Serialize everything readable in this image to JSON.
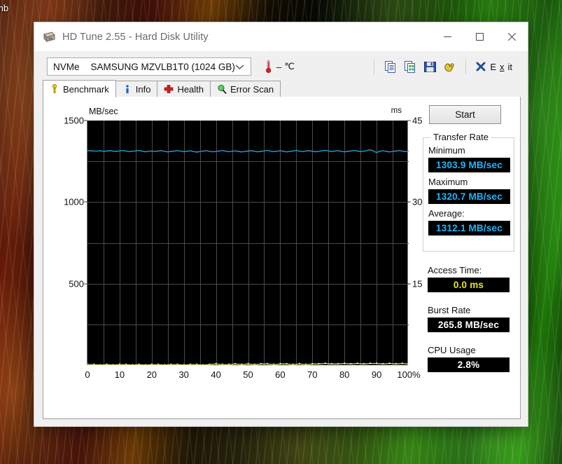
{
  "desktop": {
    "icon_label_fragment": "mb"
  },
  "window": {
    "title": "HD Tune 2.55 - Hard Disk Utility",
    "icon": "hard-disk-icon",
    "caption": {
      "minimize": "minimize-icon",
      "maximize": "maximize-icon",
      "close": "close-icon"
    }
  },
  "toolbar": {
    "drive": {
      "kind": "NVMe",
      "name": "SAMSUNG MZVLB1T0 (1024 GB)",
      "dropdown_icon": "chevron-down-icon"
    },
    "temperature": {
      "icon": "thermometer-icon",
      "value": "–",
      "unit": "℃"
    },
    "buttons": [
      {
        "name": "copy-icon",
        "label": "Copy"
      },
      {
        "name": "copy-image-icon",
        "label": "Copy image"
      },
      {
        "name": "save-icon",
        "label": "Save"
      },
      {
        "name": "settings-gloves-icon",
        "label": "Options"
      }
    ],
    "exit": {
      "icon": "exit-x-icon",
      "label_pre": "E",
      "label_accel": "x",
      "label_post": "it"
    }
  },
  "tabs": [
    {
      "id": "benchmark",
      "label": "Benchmark",
      "icon": "benchmark-icon",
      "active": true
    },
    {
      "id": "info",
      "label": "Info",
      "icon": "info-icon",
      "active": false
    },
    {
      "id": "health",
      "label": "Health",
      "icon": "health-cross-icon",
      "active": false
    },
    {
      "id": "errorscan",
      "label": "Error Scan",
      "icon": "magnifier-icon",
      "active": false
    }
  ],
  "side_panel": {
    "start_label": "Start",
    "transfer_rate": {
      "group_title": "Transfer Rate",
      "minimum_label": "Minimum",
      "minimum_value": "1303.9 MB/sec",
      "maximum_label": "Maximum",
      "maximum_value": "1320.7 MB/sec",
      "average_label": "Average:",
      "average_value": "1312.1 MB/sec"
    },
    "access_time_label": "Access Time:",
    "access_time_value": "0.0 ms",
    "burst_rate_label": "Burst Rate",
    "burst_rate_value": "265.8 MB/sec",
    "cpu_usage_label": "CPU Usage",
    "cpu_usage_value": "2.8%"
  },
  "colors": {
    "transfer_line": "#1f9fd8",
    "access_dots": "#ffff99",
    "plot_background": "#000000",
    "grid": "#4a4a4a",
    "lcd_cyan": "#1fb6ff",
    "lcd_yellow": "#e8e80e"
  },
  "chart_data": {
    "type": "line",
    "title": "",
    "xlabel": "",
    "ylabel": "MB/sec",
    "y2label": "ms",
    "xlim": [
      0,
      100
    ],
    "ylim": [
      0,
      1500
    ],
    "y2lim": [
      0,
      45
    ],
    "xtick_labels": [
      "0",
      "10",
      "20",
      "30",
      "40",
      "50",
      "60",
      "70",
      "80",
      "90",
      "100%"
    ],
    "xticks": [
      0,
      10,
      20,
      30,
      40,
      50,
      60,
      70,
      80,
      90,
      100
    ],
    "yticks": [
      500,
      1000,
      1500
    ],
    "ytick_labels": [
      "500",
      "1000",
      "1500"
    ],
    "y2ticks": [
      15,
      30,
      45
    ],
    "y2tick_labels": [
      "15",
      "30",
      "45"
    ],
    "grid": true,
    "gridlines_y": [
      250,
      500,
      750,
      1000,
      1250
    ],
    "gridlines_x": [
      5,
      10,
      15,
      20,
      25,
      30,
      35,
      40,
      45,
      50,
      55,
      60,
      65,
      70,
      75,
      80,
      85,
      90,
      95
    ],
    "legend": "none",
    "series": [
      {
        "name": "Transfer rate",
        "unit": "MB/sec",
        "axis": "left",
        "color": "#1f9fd8",
        "x": [
          0,
          1,
          2,
          3,
          4,
          5,
          6,
          7,
          8,
          9,
          10,
          11,
          12,
          13,
          14,
          15,
          16,
          17,
          18,
          19,
          20,
          21,
          22,
          23,
          24,
          25,
          26,
          27,
          28,
          29,
          30,
          31,
          32,
          33,
          34,
          35,
          36,
          37,
          38,
          39,
          40,
          41,
          42,
          43,
          44,
          45,
          46,
          47,
          48,
          49,
          50,
          51,
          52,
          53,
          54,
          55,
          56,
          57,
          58,
          59,
          60,
          61,
          62,
          63,
          64,
          65,
          66,
          67,
          68,
          69,
          70,
          71,
          72,
          73,
          74,
          75,
          76,
          77,
          78,
          79,
          80,
          81,
          82,
          83,
          84,
          85,
          86,
          87,
          88,
          89,
          90,
          91,
          92,
          93,
          94,
          95,
          96,
          97,
          98,
          99,
          100
        ],
        "values": [
          1314.2,
          1315.0,
          1313.6,
          1312.8,
          1314.6,
          1311.5,
          1313.0,
          1315.3,
          1312.2,
          1310.8,
          1313.9,
          1316.0,
          1312.4,
          1309.7,
          1311.8,
          1314.1,
          1316.4,
          1312.0,
          1308.6,
          1311.2,
          1313.5,
          1310.4,
          1312.9,
          1315.6,
          1311.1,
          1307.9,
          1310.7,
          1313.2,
          1315.8,
          1312.6,
          1309.3,
          1311.9,
          1314.4,
          1310.2,
          1306.8,
          1309.9,
          1312.7,
          1315.1,
          1311.4,
          1308.1,
          1310.6,
          1313.3,
          1316.2,
          1312.1,
          1309.0,
          1311.7,
          1314.0,
          1310.9,
          1307.5,
          1310.3,
          1313.1,
          1315.4,
          1311.8,
          1308.4,
          1311.0,
          1313.7,
          1316.6,
          1312.5,
          1309.6,
          1312.0,
          1314.8,
          1311.3,
          1308.0,
          1310.5,
          1313.4,
          1316.9,
          1312.3,
          1309.8,
          1312.6,
          1315.2,
          1311.6,
          1308.9,
          1311.5,
          1314.3,
          1317.0,
          1313.8,
          1310.1,
          1312.4,
          1315.5,
          1311.2,
          1308.3,
          1310.8,
          1313.6,
          1316.3,
          1312.9,
          1309.4,
          1312.2,
          1315.7,
          1320.7,
          1313.1,
          1303.9,
          1311.6,
          1314.9,
          1311.0,
          1307.7,
          1310.0,
          1313.0,
          1316.1,
          1312.8,
          1309.2,
          1312.3
        ],
        "min": 1303.9,
        "max": 1320.7,
        "avg": 1312.1
      },
      {
        "name": "Access time",
        "unit": "ms",
        "axis": "right",
        "color": "#ffff99",
        "x": [
          0,
          2,
          4,
          6,
          8,
          10,
          12,
          14,
          16,
          18,
          20,
          22,
          24,
          26,
          28,
          30,
          32,
          34,
          36,
          38,
          40,
          42,
          44,
          46,
          48,
          50,
          52,
          54,
          56,
          58,
          60,
          62,
          64,
          66,
          68,
          70,
          72,
          74,
          76,
          78,
          80,
          82,
          84,
          86,
          88,
          90,
          92,
          94,
          96,
          98,
          100
        ],
        "values": [
          0.1,
          0.1,
          0.0,
          0.1,
          0.0,
          0.1,
          0.1,
          0.0,
          0.1,
          0.0,
          0.1,
          0.1,
          0.0,
          0.1,
          0.1,
          0.0,
          0.1,
          0.1,
          0.0,
          0.1,
          0.2,
          0.1,
          0.1,
          0.2,
          0.1,
          0.2,
          0.1,
          0.2,
          0.2,
          0.1,
          0.2,
          0.2,
          0.1,
          0.2,
          0.1,
          0.2,
          0.2,
          0.3,
          0.2,
          0.2,
          0.3,
          0.2,
          0.3,
          0.2,
          0.3,
          0.3,
          0.2,
          0.3,
          0.2,
          0.3,
          0.2
        ],
        "avg": 0.0
      }
    ]
  }
}
